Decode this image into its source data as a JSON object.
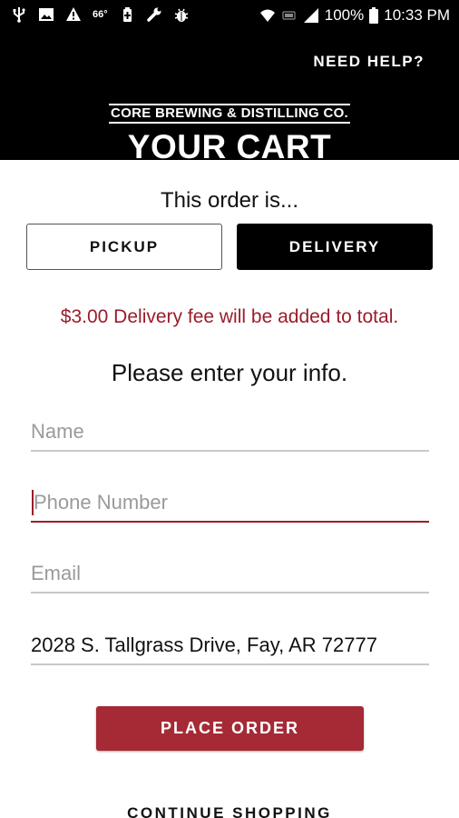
{
  "status_bar": {
    "temperature": "66°",
    "battery_percent": "100%",
    "time": "10:33 PM",
    "icons": [
      "usb-icon",
      "image-icon",
      "warning-icon",
      "battery-saver-icon",
      "wrench-icon",
      "bug-icon",
      "wifi-icon",
      "network-icon",
      "signal-icon",
      "battery-icon"
    ]
  },
  "header": {
    "need_help": "NEED HELP?",
    "brand": "CORE BREWING & DISTILLING CO.",
    "title": "YOUR CART"
  },
  "order_type": {
    "prompt": "This order is...",
    "pickup_label": "PICKUP",
    "delivery_label": "DELIVERY",
    "selected": "DELIVERY"
  },
  "fee_notice": "$3.00 Delivery fee will be added to total.",
  "info_prompt": "Please enter your info.",
  "form": {
    "name_placeholder": "Name",
    "phone_placeholder": "Phone Number",
    "email_placeholder": "Email",
    "address_value": "2028 S. Tallgrass Drive, Fay, AR 72777"
  },
  "actions": {
    "place_order": "PLACE ORDER",
    "continue_shopping": "CONTINUE SHOPPING"
  },
  "colors": {
    "accent": "#a52a35",
    "fee_text": "#9b1c2a",
    "header_bg": "#000000"
  }
}
